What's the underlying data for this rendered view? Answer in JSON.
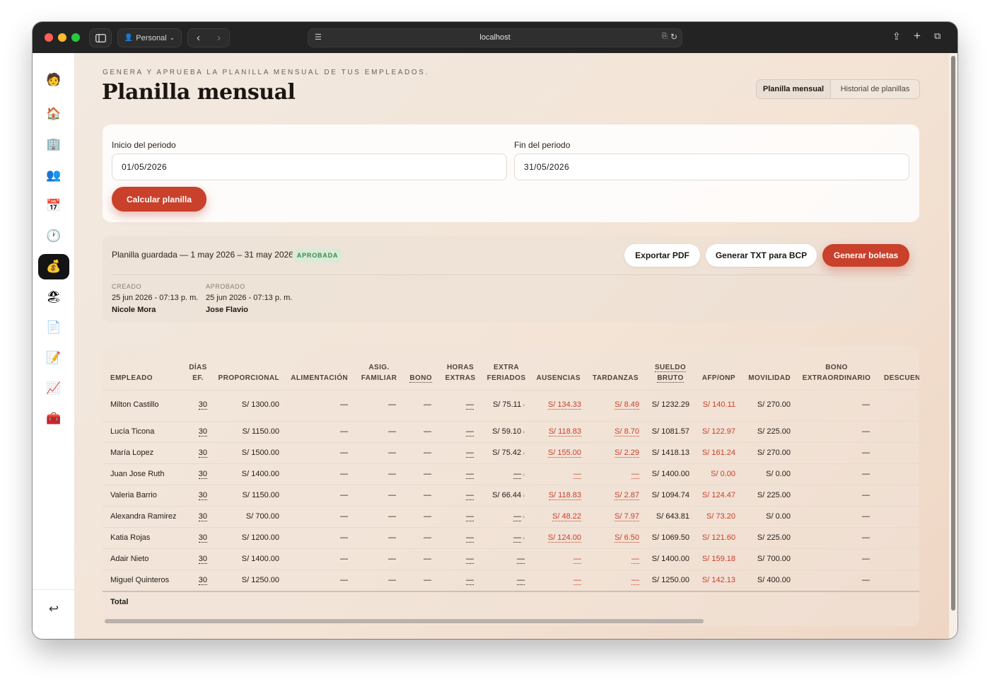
{
  "browser": {
    "profile_label": "Personal",
    "url": "localhost"
  },
  "sidebar": {
    "items": [
      {
        "icon": "avatar-logo-icon",
        "glyph": "🧑"
      },
      {
        "icon": "home-icon",
        "glyph": "🏠"
      },
      {
        "icon": "building-icon",
        "glyph": "🏢"
      },
      {
        "icon": "people-icon",
        "glyph": "👥"
      },
      {
        "icon": "calendar-icon",
        "glyph": "📅"
      },
      {
        "icon": "clock-icon",
        "glyph": "🕐"
      },
      {
        "icon": "money-bag-icon",
        "glyph": "💰"
      },
      {
        "icon": "beach-icon",
        "glyph": "🏖"
      },
      {
        "icon": "document-icon",
        "glyph": "📄"
      },
      {
        "icon": "memo-icon",
        "glyph": "📝"
      },
      {
        "icon": "chart-icon",
        "glyph": "📈"
      },
      {
        "icon": "toolbox-icon",
        "glyph": "🧰"
      }
    ],
    "logout_glyph": "↩"
  },
  "header": {
    "eyebrow": "GENERA Y APRUEBA LA PLANILLA MENSUAL DE TUS EMPLEADOS.",
    "title": "Planilla mensual",
    "tabs": [
      "Planilla mensual",
      "Historial de planillas"
    ]
  },
  "period": {
    "start_label": "Inicio del periodo",
    "start_value": "01/05/2026",
    "end_label": "Fin del periodo",
    "end_value": "31/05/2026",
    "calculate_button": "Calcular planilla"
  },
  "saved": {
    "title": "Planilla guardada — 1 may 2026 – 31 may 2026",
    "status": "APROBADA",
    "export_pdf": "Exportar PDF",
    "generate_txt": "Generar TXT para BCP",
    "generate_slips": "Generar boletas",
    "created_label": "CREADO",
    "created_date": "25 jun 2026 - 07:13 p. m.",
    "created_by": "Nicole Mora",
    "approved_label": "APROBADO",
    "approved_date": "25 jun 2026 - 07:13 p. m.",
    "approved_by": "Jose Flavio"
  },
  "table": {
    "headers": {
      "empleado": "EMPLEADO",
      "dias_1": "DÍAS",
      "dias_2": "EF.",
      "proporcional": "PROPORCIONAL",
      "alimentacion": "ALIMENTACIÓN",
      "asig_1": "ASIG.",
      "asig_2": "FAMILIAR",
      "bono": "BONO",
      "horas_1": "HORAS",
      "horas_2": "EXTRAS",
      "extra_1": "EXTRA",
      "extra_2": "FERIADOS",
      "ausencias": "AUSENCIAS",
      "tardanzas": "TARDANZAS",
      "sueldo_1": "SUELDO",
      "sueldo_2": "BRUTO",
      "afp": "AFP/ONP",
      "movilidad": "MOVILIDAD",
      "bono_extra_1": "BONO",
      "bono_extra_2": "EXTRAORDINARIO",
      "descuentos": "DESCUEN"
    },
    "rows": [
      {
        "empleado": "Milton Castillo",
        "dias": "30",
        "proporcional": "S/ 1300.00",
        "alimentacion": "—",
        "asig": "—",
        "bono": "—",
        "horas": "—",
        "feriados": "S/ 75.11",
        "ausencias": "S/ 134.33",
        "tardanzas": "S/ 8.49",
        "bruto": "S/ 1232.29",
        "afp": "S/ 140.11",
        "movilidad": "S/ 270.00",
        "bono_extra": "—"
      },
      {
        "empleado": "Lucía Ticona",
        "dias": "30",
        "proporcional": "S/ 1150.00",
        "alimentacion": "—",
        "asig": "—",
        "bono": "—",
        "horas": "—",
        "feriados": "S/ 59.10",
        "ausencias": "S/ 118.83",
        "tardanzas": "S/ 8.70",
        "bruto": "S/ 1081.57",
        "afp": "S/ 122.97",
        "movilidad": "S/ 225.00",
        "bono_extra": "—"
      },
      {
        "empleado": "María Lopez",
        "dias": "30",
        "proporcional": "S/ 1500.00",
        "alimentacion": "—",
        "asig": "—",
        "bono": "—",
        "horas": "—",
        "feriados": "S/ 75.42",
        "ausencias": "S/ 155.00",
        "tardanzas": "S/ 2.29",
        "bruto": "S/ 1418.13",
        "afp": "S/ 161.24",
        "movilidad": "S/ 270.00",
        "bono_extra": "—"
      },
      {
        "empleado": "Juan Jose Ruth",
        "dias": "30",
        "proporcional": "S/ 1400.00",
        "alimentacion": "—",
        "asig": "—",
        "bono": "—",
        "horas": "—",
        "feriados": "—",
        "ausencias": "—",
        "tardanzas": "—",
        "bruto": "S/ 1400.00",
        "afp": "S/ 0.00",
        "movilidad": "S/ 0.00",
        "bono_extra": "—"
      },
      {
        "empleado": "Valeria Barrio",
        "dias": "30",
        "proporcional": "S/ 1150.00",
        "alimentacion": "—",
        "asig": "—",
        "bono": "—",
        "horas": "—",
        "feriados": "S/ 66.44",
        "ausencias": "S/ 118.83",
        "tardanzas": "S/ 2.87",
        "bruto": "S/ 1094.74",
        "afp": "S/ 124.47",
        "movilidad": "S/ 225.00",
        "bono_extra": "—"
      },
      {
        "empleado": "Alexandra Ramirez",
        "dias": "30",
        "proporcional": "S/ 700.00",
        "alimentacion": "—",
        "asig": "—",
        "bono": "—",
        "horas": "—",
        "feriados": "—",
        "ausencias": "S/ 48.22",
        "tardanzas": "S/ 7.97",
        "bruto": "S/ 643.81",
        "afp": "S/ 73.20",
        "movilidad": "S/ 0.00",
        "bono_extra": "—"
      },
      {
        "empleado": "Katia Rojas",
        "dias": "30",
        "proporcional": "S/ 1200.00",
        "alimentacion": "—",
        "asig": "—",
        "bono": "—",
        "horas": "—",
        "feriados": "—",
        "ausencias": "S/ 124.00",
        "tardanzas": "S/ 6.50",
        "bruto": "S/ 1069.50",
        "afp": "S/ 121.60",
        "movilidad": "S/ 225.00",
        "bono_extra": "—"
      },
      {
        "empleado": "Adair Nieto",
        "dias": "30",
        "proporcional": "S/ 1400.00",
        "alimentacion": "—",
        "asig": "—",
        "bono": "—",
        "horas": "—",
        "feriados": "—",
        "ausencias": "—",
        "tardanzas": "—",
        "bruto": "S/ 1400.00",
        "afp": "S/ 159.18",
        "movilidad": "S/ 700.00",
        "bono_extra": "—"
      },
      {
        "empleado": "Miguel Quinteros",
        "dias": "30",
        "proporcional": "S/ 1250.00",
        "alimentacion": "—",
        "asig": "—",
        "bono": "—",
        "horas": "—",
        "feriados": "—",
        "ausencias": "—",
        "tardanzas": "—",
        "bruto": "S/ 1250.00",
        "afp": "S/ 142.13",
        "movilidad": "S/ 400.00",
        "bono_extra": "—"
      }
    ],
    "total_label": "Total"
  },
  "colors": {
    "accent_red": "#c9402b",
    "approved_green": "#3b8a47"
  }
}
